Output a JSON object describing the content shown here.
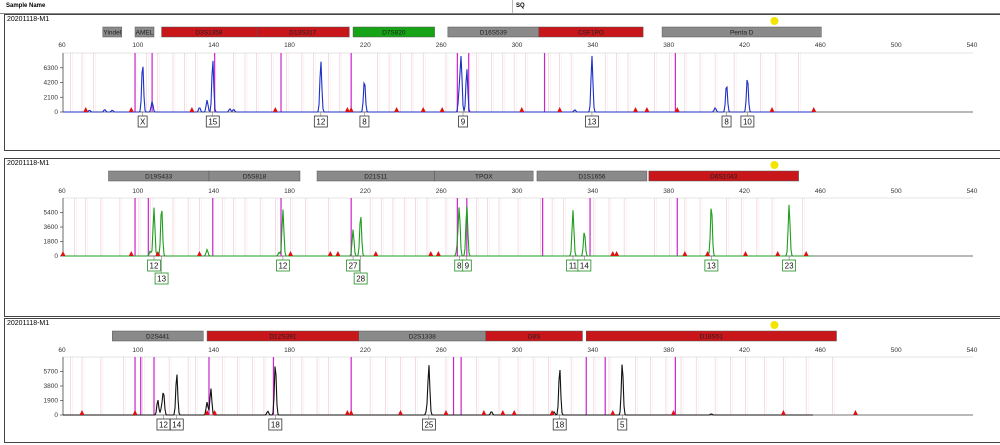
{
  "header": {
    "sample_name_label": "Sample Name",
    "sq_label": "SQ"
  },
  "axis_ticks": [
    60,
    100,
    140,
    180,
    220,
    260,
    300,
    340,
    380,
    420,
    460,
    500,
    540
  ],
  "colors": {
    "gray_marker": "#8a8a8a",
    "red_marker": "#c8161b",
    "green_marker": "#16a316",
    "blue_trace": "#1e2fc8",
    "green_trace": "#1e9e1e",
    "black_trace": "#111111",
    "bin_line": "#d98aa0",
    "ref_line": "#cc22cc",
    "peak_marker": "#dd1111",
    "sizing_star": "#f2e600"
  },
  "panels": [
    {
      "title": "20201118-M1",
      "trace_icon": "blue-trace",
      "y_ticks": [
        "6300",
        "4200",
        "2100",
        "0"
      ],
      "y_max": 8400,
      "markers": [
        {
          "label": "Yindel",
          "color": "gray",
          "from": 81,
          "to": 91
        },
        {
          "label": "AMEL",
          "color": "gray",
          "from": 98,
          "to": 108
        },
        {
          "label": "D3S1358",
          "color": "red",
          "from": 112,
          "to": 162
        },
        {
          "label": "D13S317",
          "color": "red",
          "from": 162,
          "to": 211
        },
        {
          "label": "D7S820",
          "color": "green",
          "from": 213,
          "to": 256
        },
        {
          "label": "D16S539",
          "color": "gray",
          "from": 263,
          "to": 311
        },
        {
          "label": "CSF1PO",
          "color": "red",
          "from": 311,
          "to": 366
        },
        {
          "label": "Penta D",
          "color": "gray",
          "from": 376,
          "to": 460
        }
      ],
      "peaks": [
        {
          "x": 102,
          "h": 7000
        },
        {
          "x": 107,
          "h": 1500
        },
        {
          "x": 136,
          "h": 1700
        },
        {
          "x": 139,
          "h": 7500
        },
        {
          "x": 196,
          "h": 7300
        },
        {
          "x": 219,
          "h": 4600
        },
        {
          "x": 269,
          "h": 2800
        },
        {
          "x": 270,
          "h": 7600
        },
        {
          "x": 273,
          "h": 6200
        },
        {
          "x": 339,
          "h": 8000
        },
        {
          "x": 410,
          "h": 4000
        },
        {
          "x": 421,
          "h": 5000
        }
      ],
      "calls": [
        {
          "label": "X",
          "x": 102,
          "row": 0
        },
        {
          "label": "15",
          "x": 139,
          "row": 0
        },
        {
          "label": "12",
          "x": 196,
          "row": 0
        },
        {
          "label": "8",
          "x": 219,
          "row": 0
        },
        {
          "label": "9",
          "x": 271,
          "row": 0
        },
        {
          "label": "13",
          "x": 339,
          "row": 0
        },
        {
          "label": "8",
          "x": 410,
          "row": 0
        },
        {
          "label": "10",
          "x": 421,
          "row": 0
        }
      ]
    },
    {
      "title": "20201118-M1",
      "trace_icon": "green-trace",
      "y_ticks": [
        "5400",
        "3600",
        "1800",
        "0"
      ],
      "y_max": 7200,
      "markers": [
        {
          "label": "D19S433",
          "color": "gray",
          "from": 84,
          "to": 137
        },
        {
          "label": "D5S818",
          "color": "gray",
          "from": 137,
          "to": 185
        },
        {
          "label": "D21S11",
          "color": "gray",
          "from": 194,
          "to": 256
        },
        {
          "label": "TPOX",
          "color": "gray",
          "from": 256,
          "to": 308
        },
        {
          "label": "D1S1656",
          "color": "gray",
          "from": 310,
          "to": 368
        },
        {
          "label": "D6S1043",
          "color": "red",
          "from": 369,
          "to": 448
        }
      ],
      "peaks": [
        {
          "x": 108,
          "h": 6000
        },
        {
          "x": 112,
          "h": 6200
        },
        {
          "x": 176,
          "h": 5800
        },
        {
          "x": 213,
          "h": 3300
        },
        {
          "x": 217,
          "h": 5200
        },
        {
          "x": 269,
          "h": 6000
        },
        {
          "x": 273,
          "h": 6300
        },
        {
          "x": 329,
          "h": 5700
        },
        {
          "x": 335,
          "h": 3100
        },
        {
          "x": 402,
          "h": 6400
        },
        {
          "x": 443,
          "h": 6400
        }
      ],
      "calls": [
        {
          "label": "12",
          "x": 108,
          "row": 0
        },
        {
          "label": "13",
          "x": 112,
          "row": 1
        },
        {
          "label": "12",
          "x": 176,
          "row": 0
        },
        {
          "label": "27",
          "x": 213,
          "row": 0
        },
        {
          "label": "28",
          "x": 217,
          "row": 1
        },
        {
          "label": "8",
          "x": 269,
          "row": 0
        },
        {
          "label": "9",
          "x": 273,
          "row": 0
        },
        {
          "label": "11",
          "x": 329,
          "row": 0
        },
        {
          "label": "14",
          "x": 335,
          "row": 0
        },
        {
          "label": "13",
          "x": 402,
          "row": 0
        },
        {
          "label": "23",
          "x": 443,
          "row": 0
        }
      ]
    },
    {
      "title": "20201118-M1",
      "trace_icon": "black-trace",
      "y_ticks": [
        "5700",
        "3800",
        "1900",
        "0"
      ],
      "y_max": 7600,
      "markers": [
        {
          "label": "D2S441",
          "color": "gray",
          "from": 86,
          "to": 134
        },
        {
          "label": "D12S391",
          "color": "red",
          "from": 136,
          "to": 216
        },
        {
          "label": "D2S1338",
          "color": "gray",
          "from": 216,
          "to": 283
        },
        {
          "label": "D8S",
          "color": "red",
          "from": 283,
          "to": 334
        },
        {
          "label": "D18S51",
          "color": "red",
          "from": 336,
          "to": 468
        }
      ],
      "peaks": [
        {
          "x": 110,
          "h": 2000
        },
        {
          "x": 113,
          "h": 3000
        },
        {
          "x": 120,
          "h": 5500
        },
        {
          "x": 138,
          "h": 3500
        },
        {
          "x": 172,
          "h": 6800
        },
        {
          "x": 253,
          "h": 6500
        },
        {
          "x": 322,
          "h": 6200
        },
        {
          "x": 355,
          "h": 6900
        }
      ],
      "calls": [
        {
          "label": "12",
          "x": 113,
          "row": 0
        },
        {
          "label": "14",
          "x": 120,
          "row": 0
        },
        {
          "label": "18",
          "x": 172,
          "row": 0
        },
        {
          "label": "25",
          "x": 253,
          "row": 0
        },
        {
          "label": "18",
          "x": 322,
          "row": 0
        },
        {
          "label": "5",
          "x": 355,
          "row": 0
        }
      ]
    }
  ]
}
